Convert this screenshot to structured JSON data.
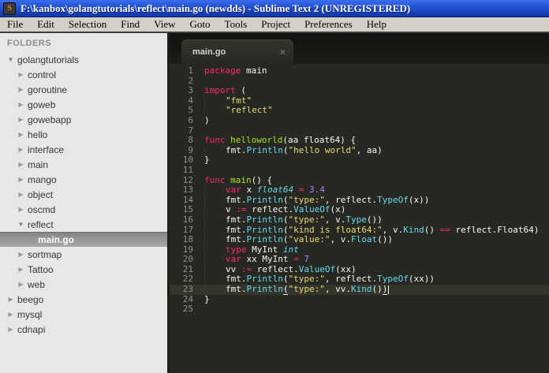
{
  "window": {
    "title": "F:\\kanbox\\golangtutorials\\reflect\\main.go (newdds) - Sublime Text 2 (UNREGISTERED)",
    "app_icon_glyph": "S"
  },
  "colors": {
    "titlebar": "#2353d6",
    "menubar_bg": "#d4d0c8",
    "sidebar_bg": "#e7e7e7",
    "editor_bg": "#272822",
    "gutter": "#8f908a",
    "plain": "#f8f8f2",
    "keyword": "#f92672",
    "string": "#e6db74",
    "func": "#66d9ef",
    "type": "#66d9ef",
    "fname": "#a6e22e",
    "number": "#ae81ff"
  },
  "menu": {
    "items": [
      "File",
      "Edit",
      "Selection",
      "Find",
      "View",
      "Goto",
      "Tools",
      "Project",
      "Preferences",
      "Help"
    ]
  },
  "sidebar": {
    "header": "FOLDERS",
    "items": [
      {
        "label": "golangtutorials",
        "level": 0,
        "kind": "folder",
        "expanded": true,
        "selected": false
      },
      {
        "label": "control",
        "level": 1,
        "kind": "folder",
        "expanded": false,
        "selected": false
      },
      {
        "label": "goroutine",
        "level": 1,
        "kind": "folder",
        "expanded": false,
        "selected": false
      },
      {
        "label": "goweb",
        "level": 1,
        "kind": "folder",
        "expanded": false,
        "selected": false
      },
      {
        "label": "gowebapp",
        "level": 1,
        "kind": "folder",
        "expanded": false,
        "selected": false
      },
      {
        "label": "hello",
        "level": 1,
        "kind": "folder",
        "expanded": false,
        "selected": false
      },
      {
        "label": "interface",
        "level": 1,
        "kind": "folder",
        "expanded": false,
        "selected": false
      },
      {
        "label": "main",
        "level": 1,
        "kind": "folder",
        "expanded": false,
        "selected": false
      },
      {
        "label": "mango",
        "level": 1,
        "kind": "folder",
        "expanded": false,
        "selected": false
      },
      {
        "label": "object",
        "level": 1,
        "kind": "folder",
        "expanded": false,
        "selected": false
      },
      {
        "label": "oscmd",
        "level": 1,
        "kind": "folder",
        "expanded": false,
        "selected": false
      },
      {
        "label": "reflect",
        "level": 1,
        "kind": "folder",
        "expanded": true,
        "selected": false
      },
      {
        "label": "main.go",
        "level": 2,
        "kind": "file",
        "expanded": false,
        "selected": true
      },
      {
        "label": "sortmap",
        "level": 1,
        "kind": "folder",
        "expanded": false,
        "selected": false
      },
      {
        "label": "Tattoo",
        "level": 1,
        "kind": "folder",
        "expanded": false,
        "selected": false
      },
      {
        "label": "web",
        "level": 1,
        "kind": "folder",
        "expanded": false,
        "selected": false
      },
      {
        "label": "beego",
        "level": 0,
        "kind": "folder",
        "expanded": false,
        "selected": false
      },
      {
        "label": "mysql",
        "level": 0,
        "kind": "folder",
        "expanded": false,
        "selected": false
      },
      {
        "label": "cdnapi",
        "level": 0,
        "kind": "folder",
        "expanded": false,
        "selected": false
      }
    ],
    "collapsed_arrow": "▶",
    "expanded_arrow": "▼"
  },
  "tabbar": {
    "tabs": [
      {
        "label": "main.go",
        "close_glyph": "×",
        "active": true
      }
    ]
  },
  "editor": {
    "current_line": 23,
    "lines": [
      {
        "num": 1,
        "ind": 0,
        "tokens": [
          [
            "k",
            "package"
          ],
          [
            "p",
            " main"
          ]
        ]
      },
      {
        "num": 2,
        "ind": 0,
        "tokens": []
      },
      {
        "num": 3,
        "ind": 0,
        "tokens": [
          [
            "k",
            "import"
          ],
          [
            "p",
            " ("
          ]
        ]
      },
      {
        "num": 4,
        "ind": 1,
        "tokens": [
          [
            "s",
            "\"fmt\""
          ]
        ]
      },
      {
        "num": 5,
        "ind": 1,
        "tokens": [
          [
            "s",
            "\"reflect\""
          ]
        ]
      },
      {
        "num": 6,
        "ind": 0,
        "tokens": [
          [
            "p",
            ")"
          ]
        ]
      },
      {
        "num": 7,
        "ind": 0,
        "tokens": []
      },
      {
        "num": 8,
        "ind": 0,
        "tokens": [
          [
            "k",
            "func"
          ],
          [
            "p",
            " "
          ],
          [
            "fn",
            "helloworld"
          ],
          [
            "p",
            "(aa float64) {"
          ]
        ]
      },
      {
        "num": 9,
        "ind": 1,
        "tokens": [
          [
            "p",
            "fmt."
          ],
          [
            "f",
            "Println"
          ],
          [
            "p",
            "("
          ],
          [
            "s",
            "\"hello world\""
          ],
          [
            "p",
            ", aa)"
          ]
        ]
      },
      {
        "num": 10,
        "ind": 0,
        "tokens": [
          [
            "p",
            "}"
          ]
        ]
      },
      {
        "num": 11,
        "ind": 0,
        "tokens": []
      },
      {
        "num": 12,
        "ind": 0,
        "tokens": [
          [
            "k",
            "func"
          ],
          [
            "p",
            " "
          ],
          [
            "fn",
            "main"
          ],
          [
            "p",
            "() {"
          ]
        ]
      },
      {
        "num": 13,
        "ind": 1,
        "tokens": [
          [
            "k",
            "var"
          ],
          [
            "p",
            " x "
          ],
          [
            "t",
            "float64"
          ],
          [
            "p",
            " "
          ],
          [
            "k",
            "="
          ],
          [
            "p",
            " "
          ],
          [
            "n",
            "3.4"
          ]
        ]
      },
      {
        "num": 14,
        "ind": 1,
        "tokens": [
          [
            "p",
            "fmt."
          ],
          [
            "f",
            "Println"
          ],
          [
            "p",
            "("
          ],
          [
            "s",
            "\"type:\""
          ],
          [
            "p",
            ", reflect."
          ],
          [
            "f",
            "TypeOf"
          ],
          [
            "p",
            "(x))"
          ]
        ]
      },
      {
        "num": 15,
        "ind": 1,
        "tokens": [
          [
            "p",
            "v "
          ],
          [
            "k",
            ":="
          ],
          [
            "p",
            " reflect."
          ],
          [
            "f",
            "ValueOf"
          ],
          [
            "p",
            "(x)"
          ]
        ]
      },
      {
        "num": 16,
        "ind": 1,
        "tokens": [
          [
            "p",
            "fmt."
          ],
          [
            "f",
            "Println"
          ],
          [
            "p",
            "("
          ],
          [
            "s",
            "\"type:\""
          ],
          [
            "p",
            ", v."
          ],
          [
            "f",
            "Type"
          ],
          [
            "p",
            "())"
          ]
        ]
      },
      {
        "num": 17,
        "ind": 1,
        "tokens": [
          [
            "p",
            "fmt."
          ],
          [
            "f",
            "Println"
          ],
          [
            "p",
            "("
          ],
          [
            "s",
            "\"kind is float64:\""
          ],
          [
            "p",
            ", v."
          ],
          [
            "f",
            "Kind"
          ],
          [
            "p",
            "() "
          ],
          [
            "k",
            "=="
          ],
          [
            "p",
            " reflect.Float64)"
          ]
        ]
      },
      {
        "num": 18,
        "ind": 1,
        "tokens": [
          [
            "p",
            "fmt."
          ],
          [
            "f",
            "Println"
          ],
          [
            "p",
            "("
          ],
          [
            "s",
            "\"value:\""
          ],
          [
            "p",
            ", v."
          ],
          [
            "f",
            "Float"
          ],
          [
            "p",
            "())"
          ]
        ]
      },
      {
        "num": 19,
        "ind": 1,
        "tokens": [
          [
            "k",
            "type"
          ],
          [
            "p",
            " MyInt "
          ],
          [
            "t",
            "int"
          ]
        ]
      },
      {
        "num": 20,
        "ind": 1,
        "tokens": [
          [
            "k",
            "var"
          ],
          [
            "p",
            " xx MyInt "
          ],
          [
            "k",
            "="
          ],
          [
            "p",
            " "
          ],
          [
            "n",
            "7"
          ]
        ]
      },
      {
        "num": 21,
        "ind": 1,
        "tokens": [
          [
            "p",
            "vv "
          ],
          [
            "k",
            ":="
          ],
          [
            "p",
            " reflect."
          ],
          [
            "f",
            "ValueOf"
          ],
          [
            "p",
            "(xx)"
          ]
        ]
      },
      {
        "num": 22,
        "ind": 1,
        "tokens": [
          [
            "p",
            "fmt."
          ],
          [
            "f",
            "Println"
          ],
          [
            "p",
            "("
          ],
          [
            "s",
            "\"type:\""
          ],
          [
            "p",
            ", reflect."
          ],
          [
            "f",
            "TypeOf"
          ],
          [
            "p",
            "(xx))"
          ]
        ]
      },
      {
        "num": 23,
        "ind": 1,
        "tokens": [
          [
            "p",
            "fmt."
          ],
          [
            "f",
            "Println"
          ],
          [
            "u",
            "("
          ],
          [
            "s",
            "\"type:\""
          ],
          [
            "p",
            ", vv."
          ],
          [
            "f",
            "Kind"
          ],
          [
            "p",
            "()"
          ],
          [
            "u",
            ")"
          ],
          [
            "caret",
            ""
          ]
        ]
      },
      {
        "num": 24,
        "ind": 0,
        "tokens": [
          [
            "p",
            "}"
          ]
        ]
      },
      {
        "num": 25,
        "ind": 0,
        "tokens": []
      }
    ]
  }
}
